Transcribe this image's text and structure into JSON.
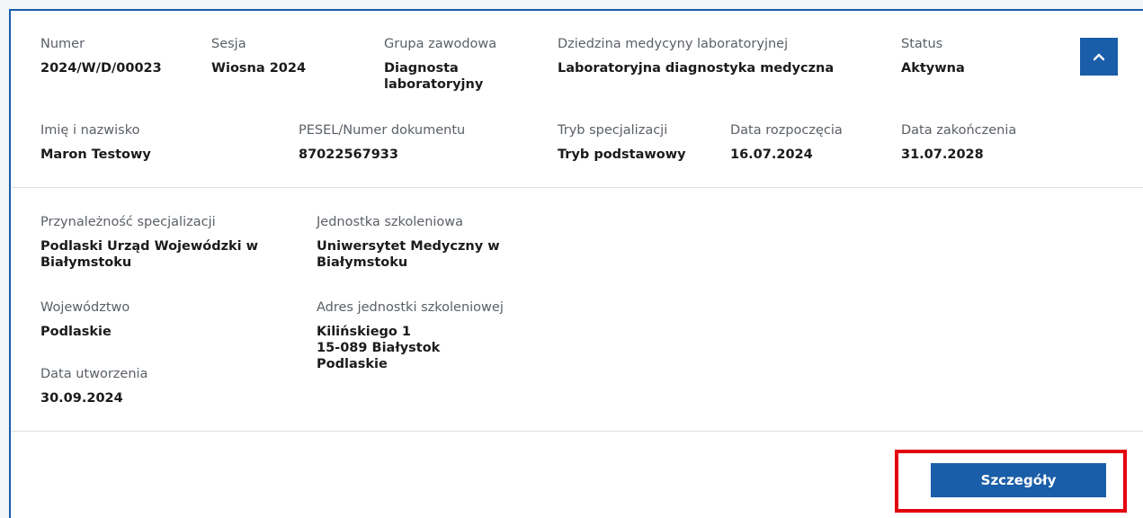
{
  "header": {
    "numer": {
      "label": "Numer",
      "value": "2024/W/D/00023"
    },
    "sesja": {
      "label": "Sesja",
      "value": "Wiosna 2024"
    },
    "grupa": {
      "label": "Grupa zawodowa",
      "value": "Diagnosta\nlaboratoryjny"
    },
    "dziedzina": {
      "label": "Dziedzina medycyny laboratoryjnej",
      "value": "Laboratoryjna diagnostyka medyczna"
    },
    "status": {
      "label": "Status",
      "value": "Aktywna"
    },
    "imie": {
      "label": "Imię i nazwisko",
      "value": "Maron Testowy"
    },
    "pesel": {
      "label": "PESEL/Numer dokumentu",
      "value": "87022567933"
    },
    "tryb": {
      "label": "Tryb specjalizacji",
      "value": "Tryb podstawowy"
    },
    "data_rozpoczecia": {
      "label": "Data rozpoczęcia",
      "value": "16.07.2024"
    },
    "data_zakonczenia": {
      "label": "Data zakończenia",
      "value": "31.07.2028"
    }
  },
  "details": {
    "przynaleznosc": {
      "label": "Przynależność specjalizacji",
      "value": "Podlaski Urząd Wojewódzki w\nBiałymstoku"
    },
    "jednostka": {
      "label": "Jednostka szkoleniowa",
      "value": "Uniwersytet Medyczny w\nBiałymstoku"
    },
    "wojewodztwo": {
      "label": "Województwo",
      "value": "Podlaskie"
    },
    "adres": {
      "label": "Adres jednostki szkoleniowej",
      "value": "Kilińskiego 1\n15-089 Białystok\nPodlaskie"
    },
    "data_utworzenia": {
      "label": "Data utworzenia",
      "value": "30.09.2024"
    }
  },
  "actions": {
    "details_label": "Szczegóły",
    "collapse_icon": "chevron-up-icon"
  },
  "colors": {
    "primary": "#1a5da8",
    "highlight": "#e3000f"
  }
}
